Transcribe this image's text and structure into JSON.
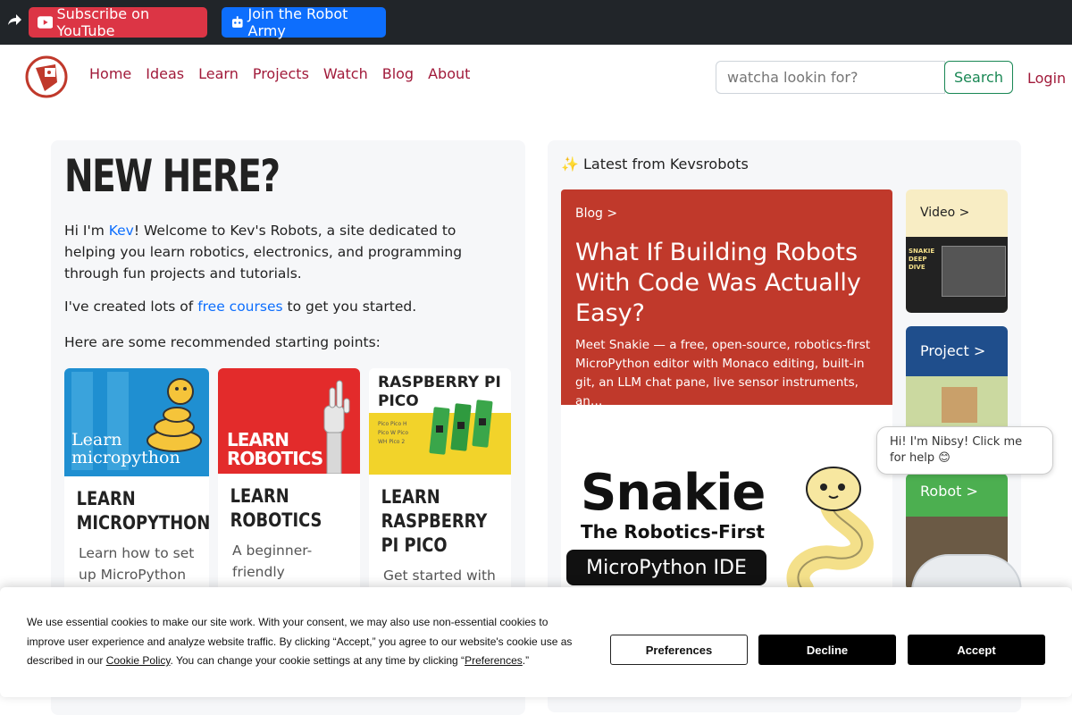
{
  "topbar": {
    "youtube_label": "Subscribe on YouTube",
    "army_label": "Join the Robot Army"
  },
  "nav": {
    "items": [
      "Home",
      "Ideas",
      "Learn",
      "Projects",
      "Watch",
      "Blog",
      "About"
    ],
    "search_placeholder": "watcha lookin for?",
    "search_label": "Search",
    "login_label": "Login"
  },
  "intro": {
    "heading": "NEW HERE?",
    "greeting_pre": "Hi I'm ",
    "greeting_link": "Kev",
    "greeting_post": "! Welcome to Kev's Robots, a site dedicated to helping you learn robotics, electronics, and programming through fun projects and tutorials.",
    "courses_pre": "I've created lots of ",
    "courses_link": "free courses",
    "courses_post": " to get you started.",
    "recommend": "Here are some recommended starting points:"
  },
  "cards": [
    {
      "thumb_text": "Learn micropython",
      "title": "LEARN MICROPYTHON",
      "desc": "Learn how to set up MicroPython"
    },
    {
      "thumb_text": "LEARN ROBOTICS",
      "title": "LEARN ROBOTICS",
      "desc": "A beginner-friendly pathway"
    },
    {
      "thumb_text": "RASPBERRY PI PICO",
      "thumb_list": "Pico Pico H Pico W Pico WH Pico 2",
      "title": "LEARN RASPBERRY PI PICO",
      "desc": "Get started with"
    }
  ],
  "latest": {
    "heading": "✨ Latest from Kevsrobots",
    "blog": {
      "tag": "Blog >",
      "title": "What If Building Robots With Code Was Actually Easy?",
      "desc": "Meet Snakie — a free, open-source, robotics-first MicroPython editor with Monaco editing, built-in git, an LLM chat pane, live sensor instruments, an…"
    },
    "snakie_title": "Snakie",
    "snakie_subtitle": "The Robotics-First",
    "snakie_pill": "MicroPython IDE",
    "video_tag": "Video >",
    "video_thumb_text": "SNAKIE DEEP DIVE",
    "project_tag": "Project >",
    "robot_tag": "Robot >"
  },
  "chat": {
    "text": "Hi! I'm Nibsy! Click me for help 😊"
  },
  "cookie": {
    "text_1": "We use essential cookies to make our site work. With your consent, we may also use non-essential cookies to improve user experience and analyze website traffic. By clicking “Accept,” you agree to our website's cookie use as described in our ",
    "policy_link": "Cookie Policy",
    "text_2": ". You can change your cookie settings at any time by clicking “",
    "prefs_link": "Preferences",
    "text_3": ".”",
    "preferences_label": "Preferences",
    "decline_label": "Decline",
    "accept_label": "Accept"
  },
  "colors": {
    "topbar": "#212529",
    "youtube": "#dc3545",
    "army": "#0d6efd",
    "nav_link": "#a11a3a",
    "search_green": "#198754",
    "blog_red": "#c0392b",
    "project_blue": "#1f4e8c",
    "robot_green": "#4caf50",
    "video_cream": "#f8edc4"
  }
}
